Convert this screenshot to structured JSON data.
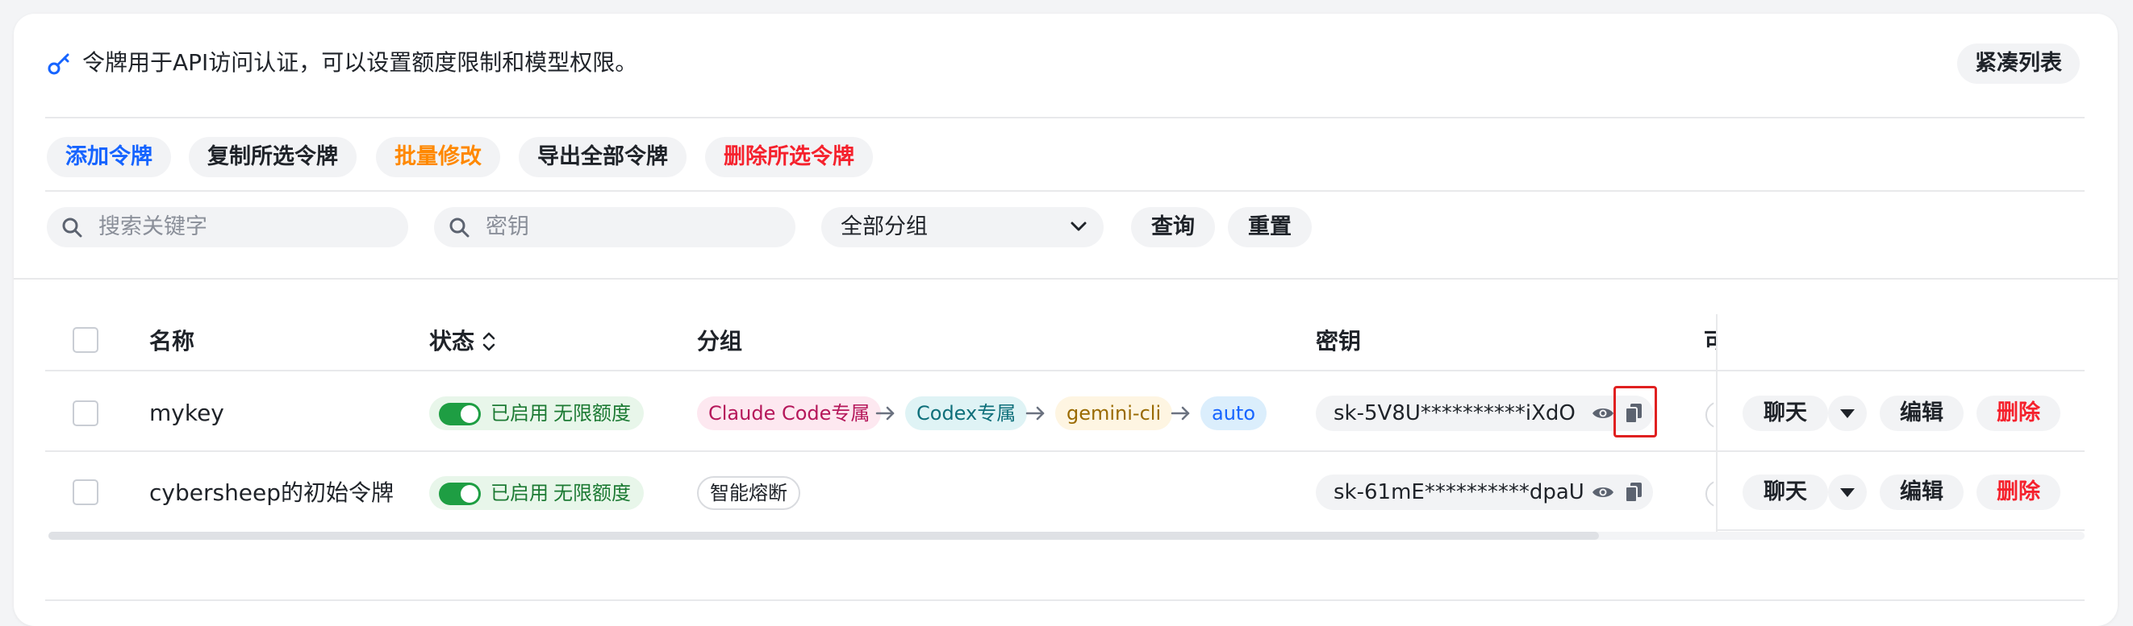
{
  "header": {
    "info_text": "令牌用于API访问认证，可以设置额度限制和模型权限。",
    "compact_label": "紧凑列表"
  },
  "toolbar": {
    "add": "添加令牌",
    "copy_selected": "复制所选令牌",
    "batch_edit": "批量修改",
    "export_all": "导出全部令牌",
    "delete_selected": "删除所选令牌"
  },
  "filters": {
    "search_placeholder": "搜索关键字",
    "key_placeholder": "密钥",
    "group_selected": "全部分组",
    "query": "查询",
    "reset": "重置"
  },
  "table": {
    "columns": {
      "name": "名称",
      "status": "状态",
      "group": "分组",
      "key": "密钥",
      "cut": "可"
    },
    "rows": [
      {
        "name": "mykey",
        "status": "已启用",
        "quota": "无限额度",
        "groups": [
          "Claude Code专属",
          "Codex专属",
          "gemini-cli",
          "auto"
        ],
        "key": "sk-5V8U**********iXdO"
      },
      {
        "name": "cybersheep的初始令牌",
        "status": "已启用",
        "quota": "无限额度",
        "groups": [
          "智能熔断"
        ],
        "key": "sk-61mE**********dpaU"
      }
    ],
    "actions": {
      "chat": "聊天",
      "edit": "编辑",
      "delete": "删除"
    }
  },
  "colors": {
    "accent_blue": "#1664ff",
    "orange": "#ff8800",
    "red": "#f5222d",
    "status_green": "#1e9e43"
  }
}
